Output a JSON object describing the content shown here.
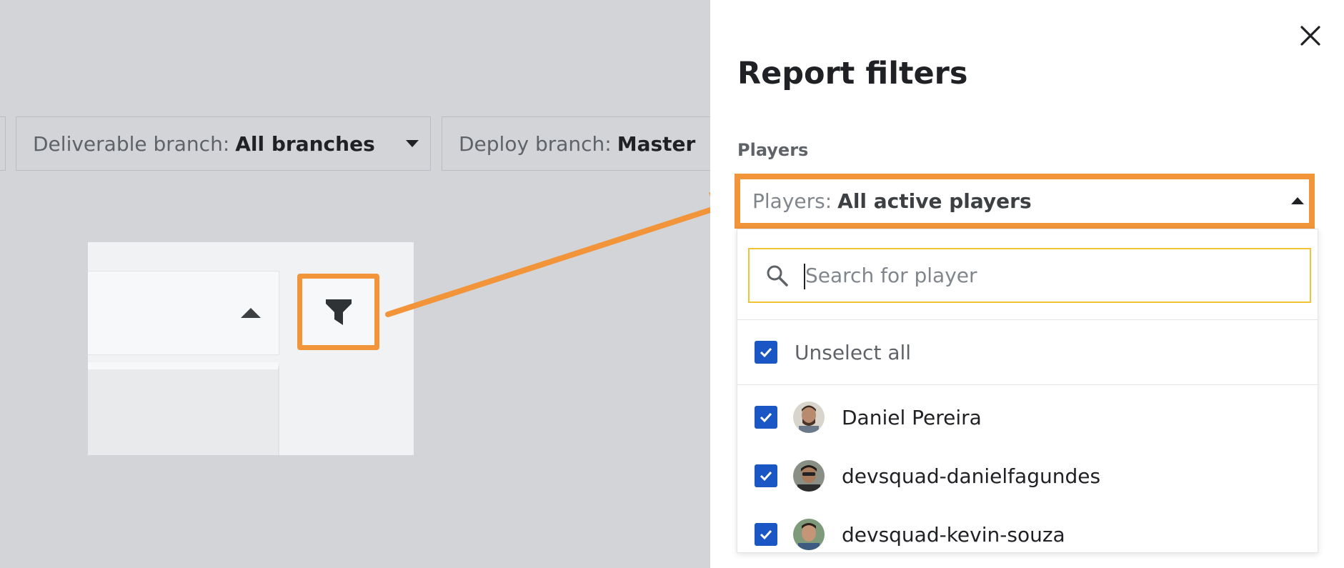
{
  "background": {
    "filters": [
      {
        "label": "Deliverable branch:",
        "value": "All branches"
      },
      {
        "label": "Deploy branch:",
        "value": "Master"
      }
    ]
  },
  "panel": {
    "title": "Report filters",
    "players_label": "Players",
    "players_select": {
      "label": "Players:",
      "value": "All active players"
    },
    "search": {
      "placeholder": "Search for player"
    },
    "unselect_all": "Unselect all",
    "players": [
      {
        "name": "Daniel Pereira",
        "checked": true
      },
      {
        "name": "devsquad-danielfagundes",
        "checked": true
      },
      {
        "name": "devsquad-kevin-souza",
        "checked": true
      }
    ]
  },
  "colors": {
    "highlight": "#f2943a",
    "checkbox": "#1a56c4",
    "search_border": "#f1c232",
    "backdrop": "#d2d4d8"
  },
  "icons": [
    "close-icon",
    "search-icon",
    "filter-funnel-icon",
    "checkmark-icon",
    "caret-down-icon",
    "caret-up-icon"
  ]
}
